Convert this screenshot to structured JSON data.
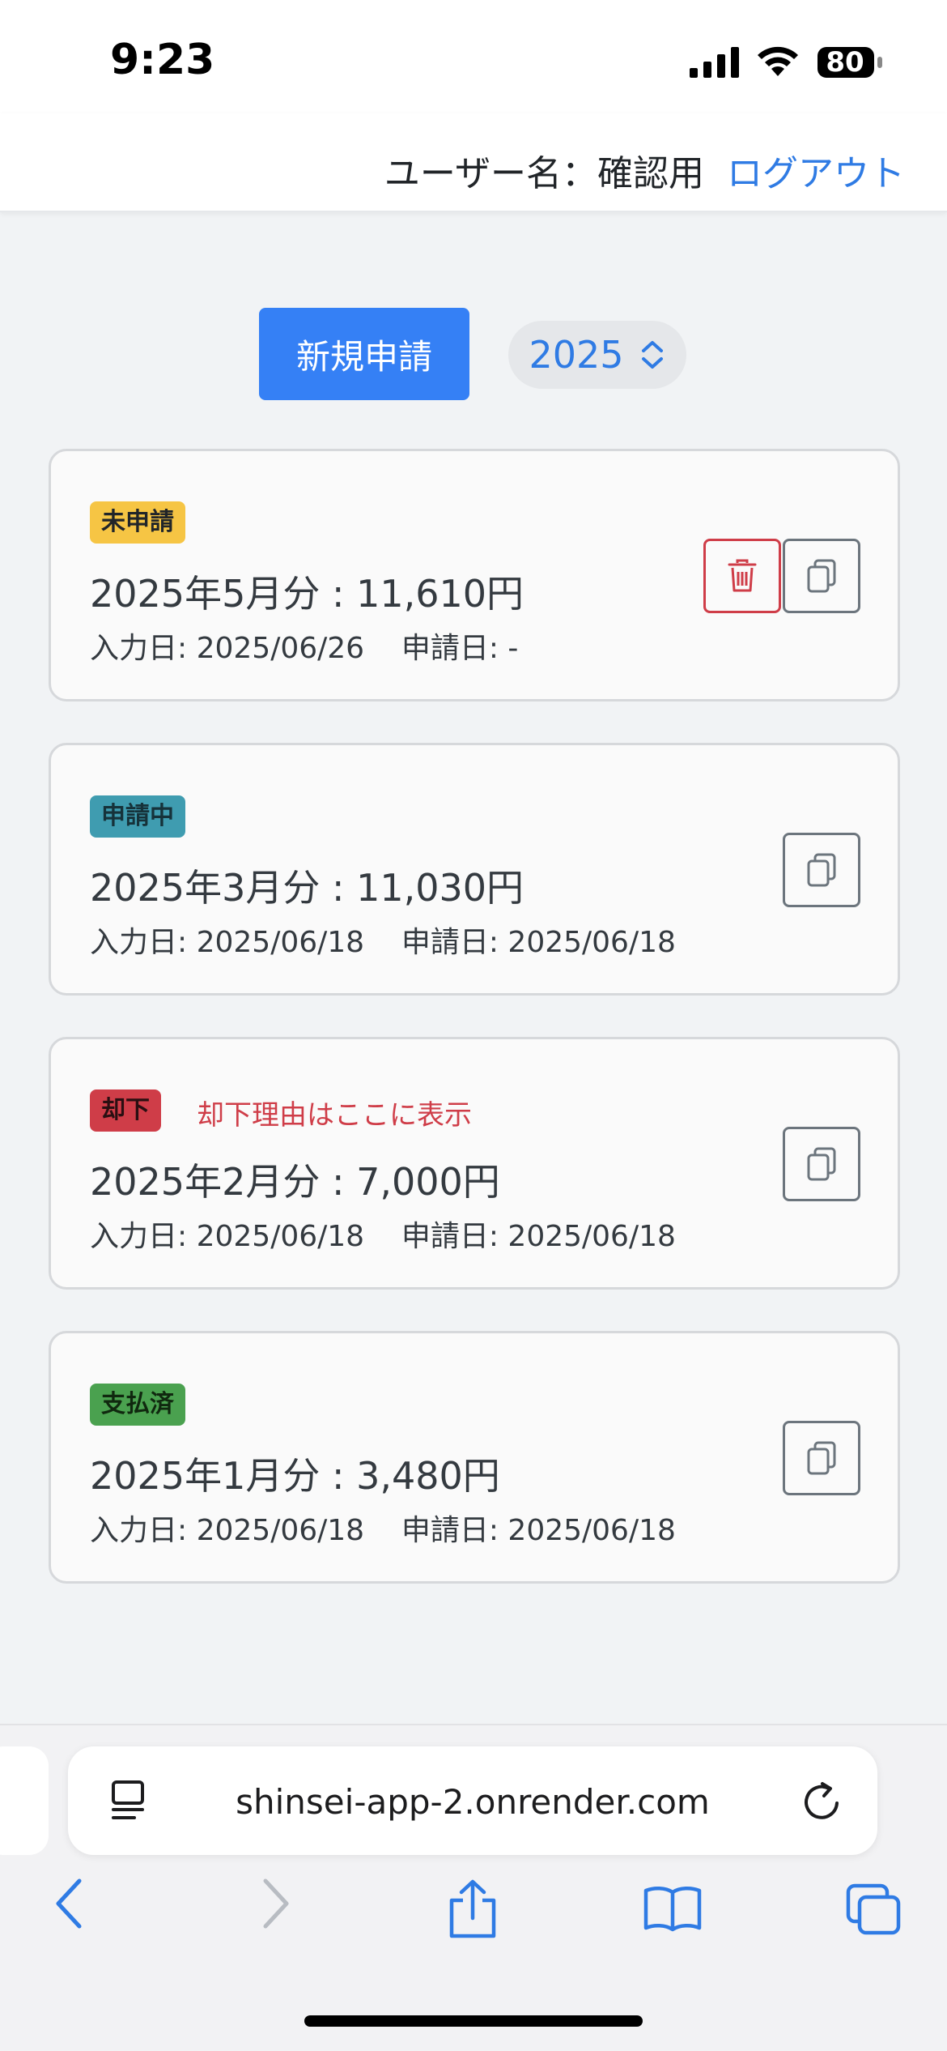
{
  "status_bar": {
    "time": "9:23",
    "battery": "80",
    "icons": [
      "signal-icon",
      "wifi-icon",
      "battery-icon"
    ]
  },
  "header": {
    "username": "ユーザー名：確認用",
    "logout_label": "ログアウト"
  },
  "controls": {
    "new_button_label": "新規申請",
    "year_value": "2025"
  },
  "applications": [
    {
      "status": "未申請",
      "status_color": "#f6c544",
      "title": "2025年5月分 : 11,610円",
      "dates": "入力日: 2025/06/26    申請日: -",
      "has_delete": true
    },
    {
      "status": "申請中",
      "status_color": "#3f9cb0",
      "title": "2025年3月分 : 11,030円",
      "dates": "入力日: 2025/06/18    申請日: 2025/06/18",
      "has_delete": false
    },
    {
      "status": "却下",
      "status_color": "#cf3d48",
      "reason": "却下理由はここに表示",
      "title": "2025年2月分 : 7,000円",
      "dates": "入力日: 2025/06/18    申請日: 2025/06/18",
      "has_delete": false
    },
    {
      "status": "支払済",
      "status_color": "#4aa14f",
      "title": "2025年1月分 : 3,480円",
      "dates": "入力日: 2025/06/18    申請日: 2025/06/18",
      "has_delete": false
    }
  ],
  "browser": {
    "url": "shinsei-app-2.onrender.com",
    "toolbar_icons": [
      "back-icon",
      "forward-icon",
      "share-icon",
      "bookmarks-icon",
      "tabs-icon"
    ]
  },
  "colors": {
    "accent": "#3580f5",
    "link": "#2f7be4",
    "danger": "#cf3d48"
  }
}
